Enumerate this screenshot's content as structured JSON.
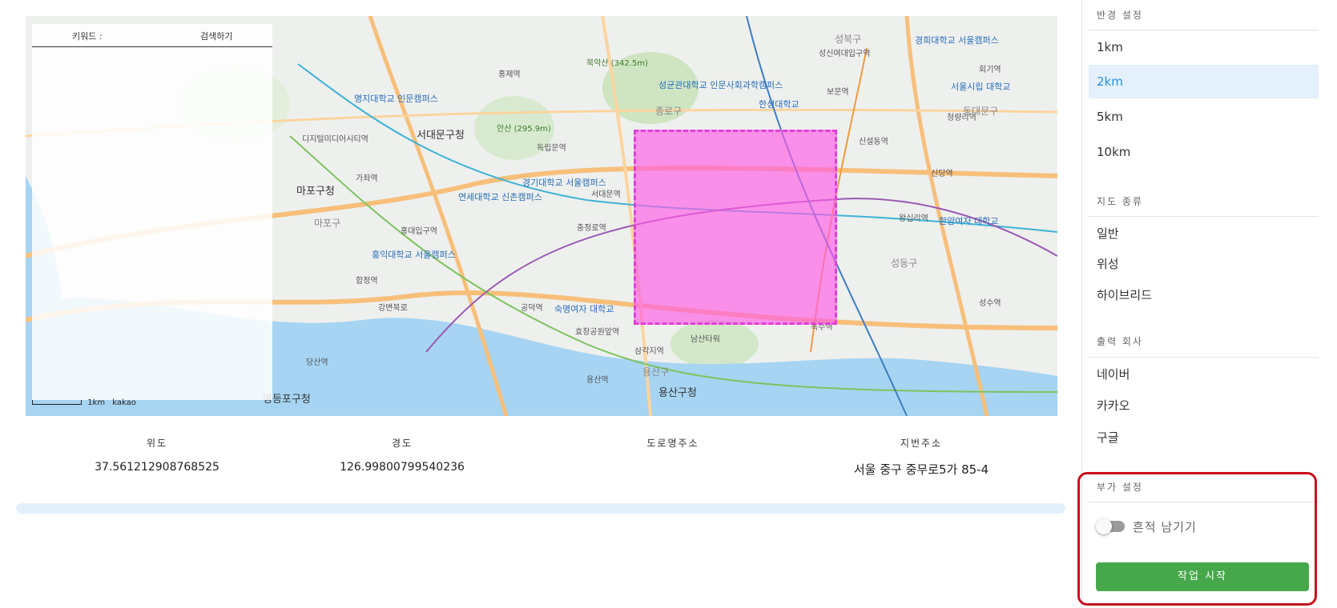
{
  "map": {
    "search_keyword_label": "키워드 :",
    "search_button_label": "검색하기",
    "scale_text": "1km",
    "provider_text": "kakao",
    "labels": [
      {
        "text": "서대문구청",
        "cls": "big"
      },
      {
        "text": "마포구청",
        "cls": "big"
      },
      {
        "text": "용산구청",
        "cls": "big"
      },
      {
        "text": "영등포구청",
        "cls": "big"
      },
      {
        "text": "북악산 (342.5m)",
        "cls": "green"
      },
      {
        "text": "안산 (295.9m)",
        "cls": "green"
      },
      {
        "text": "남산타워",
        "cls": ""
      },
      {
        "text": "명지대학교 인문캠퍼스",
        "cls": "blue"
      },
      {
        "text": "연세대학교 신촌캠퍼스",
        "cls": "blue"
      },
      {
        "text": "홍익대학교 서울캠퍼스",
        "cls": "blue"
      },
      {
        "text": "숙명여자 대학교",
        "cls": "blue"
      },
      {
        "text": "성균관대학교 인문사회과학캠퍼스",
        "cls": "blue"
      },
      {
        "text": "한성대학교",
        "cls": "blue"
      },
      {
        "text": "경희대학교 서울캠퍼스",
        "cls": "blue"
      },
      {
        "text": "서울시립 대학교",
        "cls": "blue"
      },
      {
        "text": "한양여자 대학교",
        "cls": "blue"
      },
      {
        "text": "경기대학교 서울캠퍼스",
        "cls": "blue"
      },
      {
        "text": "디지털미디어시티역",
        "cls": ""
      },
      {
        "text": "가좌역",
        "cls": ""
      },
      {
        "text": "홍대입구역",
        "cls": ""
      },
      {
        "text": "합정역",
        "cls": ""
      },
      {
        "text": "공덕역",
        "cls": ""
      },
      {
        "text": "효창공원앞역",
        "cls": ""
      },
      {
        "text": "삼각지역",
        "cls": ""
      },
      {
        "text": "용산역",
        "cls": ""
      },
      {
        "text": "충정로역",
        "cls": ""
      },
      {
        "text": "서대문역",
        "cls": ""
      },
      {
        "text": "독립문역",
        "cls": ""
      },
      {
        "text": "홍제역",
        "cls": ""
      },
      {
        "text": "신설동역",
        "cls": ""
      },
      {
        "text": "왕십리역",
        "cls": ""
      },
      {
        "text": "옥수역",
        "cls": ""
      },
      {
        "text": "성수역",
        "cls": ""
      },
      {
        "text": "회기역",
        "cls": ""
      },
      {
        "text": "보문역",
        "cls": ""
      },
      {
        "text": "신당역",
        "cls": ""
      },
      {
        "text": "당산역",
        "cls": ""
      },
      {
        "text": "성신여대입구역",
        "cls": ""
      },
      {
        "text": "청량리역",
        "cls": ""
      },
      {
        "text": "강변북로",
        "cls": ""
      },
      {
        "text": "마포구",
        "cls": ""
      },
      {
        "text": "용산구",
        "cls": ""
      },
      {
        "text": "종로구",
        "cls": ""
      },
      {
        "text": "성동구",
        "cls": ""
      },
      {
        "text": "동대문구",
        "cls": ""
      },
      {
        "text": "성북구",
        "cls": ""
      }
    ]
  },
  "info": {
    "latitude_label": "위도",
    "latitude_value": "37.561212908768525",
    "longitude_label": "경도",
    "longitude_value": "126.99800799540236",
    "road_address_label": "도로명주소",
    "road_address_value": "",
    "lot_address_label": "지번주소",
    "lot_address_value": "서울 중구 중무로5가 85-4",
    "progress_percent": 0
  },
  "sidebar": {
    "radius_title": "반경 설정",
    "radius_options": [
      "1km",
      "2km",
      "5km",
      "10km"
    ],
    "radius_selected": "2km",
    "map_type_title": "지도 종류",
    "map_type_options": [
      "일반",
      "위성",
      "하이브리드"
    ],
    "company_title": "출력 회사",
    "company_options": [
      "네이버",
      "카카오",
      "구글"
    ],
    "extra_title": "부가 설정",
    "trace_toggle_label": "흔적 남기기",
    "trace_toggle_on": false,
    "start_button_label": "작업 시작"
  },
  "colors": {
    "selection_fill": "#ff5ae6",
    "start_button": "#46a84b",
    "highlight_border": "#c8101e",
    "selected_option_bg": "#e4f0fb"
  }
}
